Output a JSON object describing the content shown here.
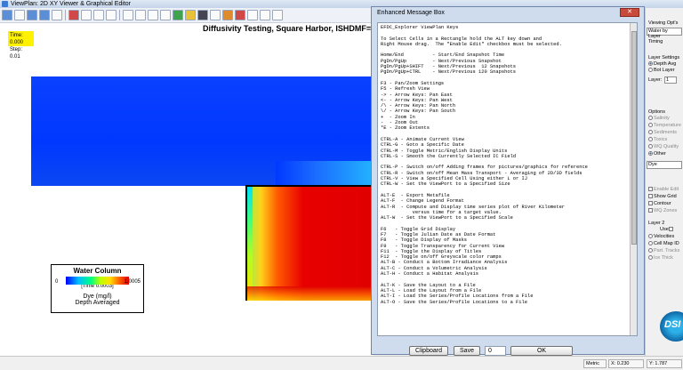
{
  "window": {
    "title": "ViewPlan: 2D XY Viewer & Graphical Editor"
  },
  "toolbar": {
    "icons": [
      "zoom-extents-icon",
      "refresh-icon",
      "zoom-in-icon",
      "zoom-out-icon",
      "pan-icon",
      "save-icon",
      "print-icon",
      "copy-icon",
      "select-icon",
      "grid-icon",
      "cell-icon",
      "polygon-icon",
      "line-icon",
      "vector-icon",
      "contour-icon",
      "flow-icon",
      "ruler-icon",
      "color-icon",
      "edit-icon",
      "paint-icon",
      "tools-icon",
      "settings-icon"
    ]
  },
  "plot": {
    "time_line1": "Time: 0.000",
    "time_line2": "Step: 0.01",
    "title": "Diffusivity Testing, Square Harbor, ISHDMF=1, Bijvelds"
  },
  "legend": {
    "title": "Water Column",
    "min": "0",
    "max": "1.0005",
    "time": "[Time 0.0003]",
    "units": "Dye (mg/l)",
    "averaging": "Depth Averaged"
  },
  "dialog": {
    "title": "Enhanced Message Box",
    "close": "✕",
    "lines": [
      "EFDC_Explorer ViewPlan Keys",
      "",
      "To Select Cells in a Rectangle hold the ALT key down and",
      "Right Mouse drag.  The \"Enable Edit\" checkbox must be selected.",
      "",
      "Home/End          - Start/End Snapshot Time",
      "PgDn/PgUp         - Next/Previous Snapshot",
      "PgDn/PgUp+SHIFT   - Next/Previous  12 Snapshots",
      "PgDn/PgUp+CTRL    - Next/Previous 120 Snapshots",
      "",
      "F3 - Pan/Zoom Settings",
      "F5 - Refresh View",
      "-> - Arrow Keys: Pan East",
      "<- - Arrow Keys: Pan West",
      "/\\ - Arrow Keys: Pan North",
      "\\/ - Arrow Keys: Pan South",
      "+  - Zoom In",
      "-  - Zoom Out",
      "*E - Zoom Extents",
      "",
      "CTRL-A - Animate Current View",
      "CTRL-G - Goto a Specific Date",
      "CTRL-M - Toggle Metric/English Display Units",
      "CTRL-S - Smooth the Currently Selected IC Field",
      "",
      "CTRL-P - Switch on/off Adding frames for pictures/graphics for reference",
      "CTRL-R - Switch on/off Mean Mass Transport - Averaging of 2D/3D fields",
      "CTRL-V - View a Specified Cell Using either L or IJ",
      "CTRL-W - Set the ViewPort to a Specified Size",
      "",
      "ALT-E  - Export Metafile",
      "ALT-F  - Change Legend Format",
      "ALT-R  - Compute and Display time series plot of River Kilometer",
      "           versus time for a target value.",
      "ALT-W  - Set the ViewPort to a Specified Scale",
      "",
      "F6   - Toggle Grid Display",
      "F7   - Toggle Julian Date as Date Format",
      "F8   - Toggle Display of Masks",
      "F9   - Toggle Transparency for Current View",
      "F11  - Toggle the Display of Titles",
      "F12  - Toggle on/off Greyscale color ramps",
      "ALT-B - Conduct a Bottom Irradiance Analysis",
      "ALT-C - Conduct a Volumetric Analysis",
      "ALT-H - Conduct a Habitat Analysis",
      "",
      "ALT-K - Save the Layout to a File",
      "ALT-L - Load the Layout from a File",
      "ALT-I - Load the Series/Profile Locations from a File",
      "ALT-O - Save the Series/Profile Locations to a File"
    ],
    "btn_clipboard": "Clipboard",
    "btn_save": "Save",
    "input_value": "0",
    "btn_ok": "OK"
  },
  "right_panel": {
    "viewing_label": "Viewing Opt's",
    "viewing_select": "Water by Layer",
    "timing_label": "Timing",
    "layer_settings_label": "Layer Settings",
    "depth_avg": "Depth Avg",
    "bot_layer": "Bot Layer",
    "layer_label": "Layer:",
    "layer_value": "1",
    "options_label": "Options",
    "options": [
      "Salinity",
      "Temperature",
      "Sediments",
      "Toxics",
      "WQ Quality",
      "Other"
    ],
    "options_selected": "Other",
    "dye_select": "Dye",
    "checks": [
      "Enable Edit",
      "Show Grid",
      "Contour",
      "WQ Zones"
    ],
    "layer2_label": "Layer 2",
    "use_label": "Use",
    "layer2_options": [
      "Velocities",
      "Cell Map ID",
      "Part. Tracks",
      "Ice Thick"
    ],
    "logo": "DSI"
  },
  "status": {
    "metric": "Metric",
    "x_coord": "X: 0.230",
    "y_coord": "Y: 1.787"
  },
  "colors": {
    "dialog_frame": "#cfdcee",
    "time_box": "#fff200",
    "legend_low": "#0000ff",
    "legend_high": "#e00000"
  }
}
